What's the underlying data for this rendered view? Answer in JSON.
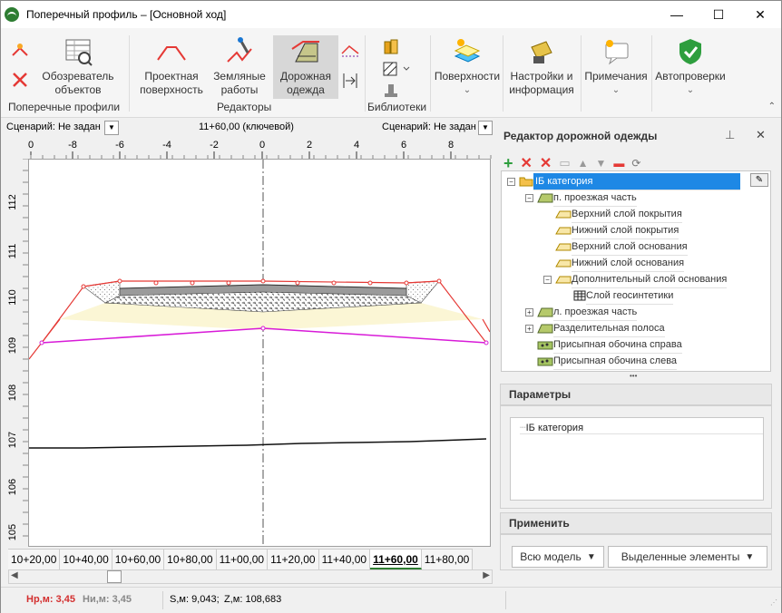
{
  "window": {
    "title": "Поперечный профиль – [Основной ход]",
    "minimize": "—",
    "maximize": "☐",
    "close": "✕"
  },
  "ribbon": {
    "profiles_group": "Поперечные профили",
    "viewer_btn": [
      "Обозреватель",
      "объектов"
    ],
    "editors_group": "Редакторы",
    "design_surface": [
      "Проектная",
      "поверхность"
    ],
    "earthworks": [
      "Земляные",
      "работы"
    ],
    "pavement": [
      "Дорожная",
      "одежда"
    ],
    "libraries_group": "Библиотеки",
    "surfaces": "Поверхности",
    "settings": [
      "Настройки и",
      "информация"
    ],
    "notes": "Примечания",
    "autochecks": "Автопроверки"
  },
  "view": {
    "scenario_left": "Сценарий: Не задан",
    "station_label": "11+60,00 (ключевой)",
    "scenario_right": "Сценарий: Не задан"
  },
  "ruler_x": [
    "0",
    "-8",
    "-6",
    "-4",
    "-2",
    "0",
    "2",
    "4",
    "6",
    "8"
  ],
  "ruler_y": [
    "112",
    "111",
    "110",
    "109",
    "108",
    "107",
    "106",
    "105"
  ],
  "stations": [
    "10+20,00",
    "10+40,00",
    "10+60,00",
    "10+80,00",
    "11+00,00",
    "11+20,00",
    "11+40,00",
    "11+60,00",
    "11+80,00"
  ],
  "selected_station": "11+60,00",
  "status": {
    "hr": "Нр,м: 3,45",
    "hn": "Ни,м: 3,45",
    "s": "S,м: 9,043;",
    "z": "Z,м: 108,683"
  },
  "editor": {
    "title": "Редактор дорожной одежды",
    "tree": [
      "IБ категория",
      "п. проезжая часть",
      "Верхний слой покрытия",
      "Нижний слой покрытия",
      "Верхний слой основания",
      "Нижний слой основания",
      "Дополнительный слой основания",
      "Слой геосинтетики",
      "л. проезжая часть",
      "Разделительная полоса",
      "Присыпная обочина справа",
      "Присыпная обочина слева"
    ],
    "ellipsis": "•••",
    "params_title": "Параметры",
    "params_item": "IБ категория",
    "apply_title": "Применить",
    "apply_all": "Всю модель",
    "apply_selected": "Выделенные элементы"
  },
  "colors": {
    "accent_green": "#2e7d32",
    "red_line": "#e53935",
    "magenta_line": "#d81bd8",
    "yellow_layer": "#fbf6d5",
    "status_red": "#d32f2f"
  }
}
